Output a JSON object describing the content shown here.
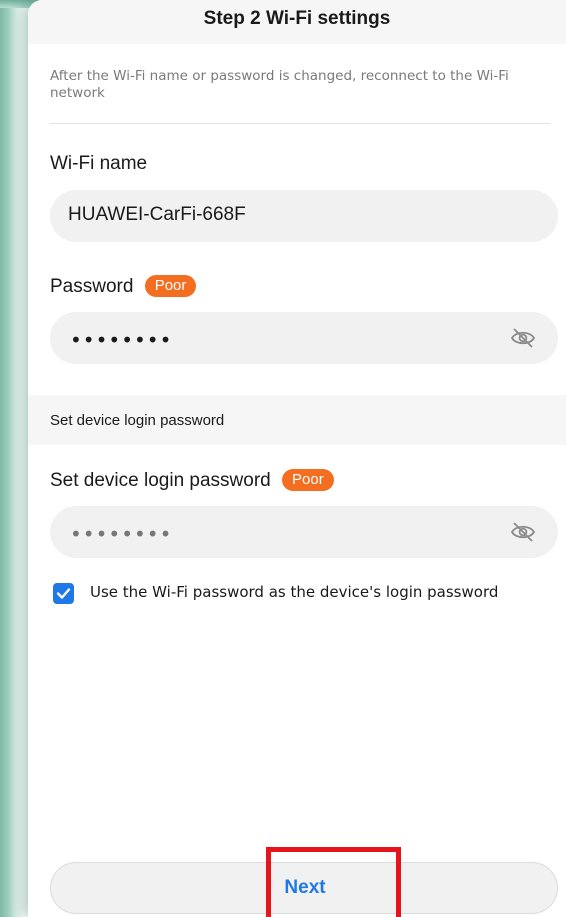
{
  "header": {
    "title": "Step 2 Wi-Fi settings"
  },
  "notice": "After the Wi-Fi name or password is changed, reconnect to the Wi-Fi network",
  "wifi_name": {
    "label": "Wi-Fi name",
    "value": "HUAWEI-CarFi-668F"
  },
  "password": {
    "label": "Password",
    "strength": "Poor",
    "masked_value": "••••••••",
    "visibility_icon": "eye-off-icon"
  },
  "device_login": {
    "section_title": "Set device login password",
    "label": "Set device login password",
    "strength": "Poor",
    "masked_value": "••••••••",
    "visibility_icon": "eye-off-icon"
  },
  "checkbox": {
    "checked": true,
    "label": "Use the Wi-Fi password as the device's login password"
  },
  "footer": {
    "next_label": "Next"
  },
  "colors": {
    "accent": "#1f78e8",
    "badge": "#f36e21",
    "highlight": "#e4161c"
  }
}
